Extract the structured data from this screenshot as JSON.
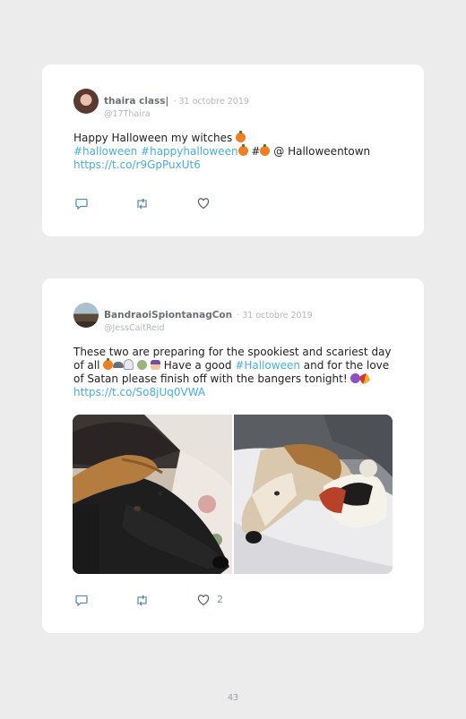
{
  "tweets": [
    {
      "author": "thaira class|",
      "date": "· 31 octobre 2019",
      "handle": "@17Thaira",
      "line1": "Happy Halloween my witches",
      "tag1": "#halloween",
      "tag2": "#happyhalloween",
      "tag3": "#",
      "at_text": "@ Halloweentown",
      "link": "https://t.co/r9GpPuxUt6",
      "likes": ""
    },
    {
      "author": "BandraoiSpiontanagCon",
      "date": "· 31 octobre 2019",
      "handle": "@JessCaitReid",
      "line1": "These two are preparing for the spookiest and scariest day",
      "line2a": "of all",
      "line2b": "Have a good",
      "tag1": "#Halloween",
      "line2c": "and for the love",
      "line3": "of Satan please finish off with the bangers tonight!",
      "link": "https://t.co/So8jUq0VWA",
      "likes": "2"
    }
  ],
  "page_number": "43",
  "icons": [
    "reply-icon",
    "retweet-icon",
    "like-icon",
    "pumpkin-icon",
    "bat-icon",
    "ghost-icon",
    "zombie-icon",
    "witch-icon",
    "devil-icon",
    "firework-icon"
  ],
  "colors": {
    "link": "#45aee8",
    "background": "#ececec",
    "card": "#ffffff"
  }
}
